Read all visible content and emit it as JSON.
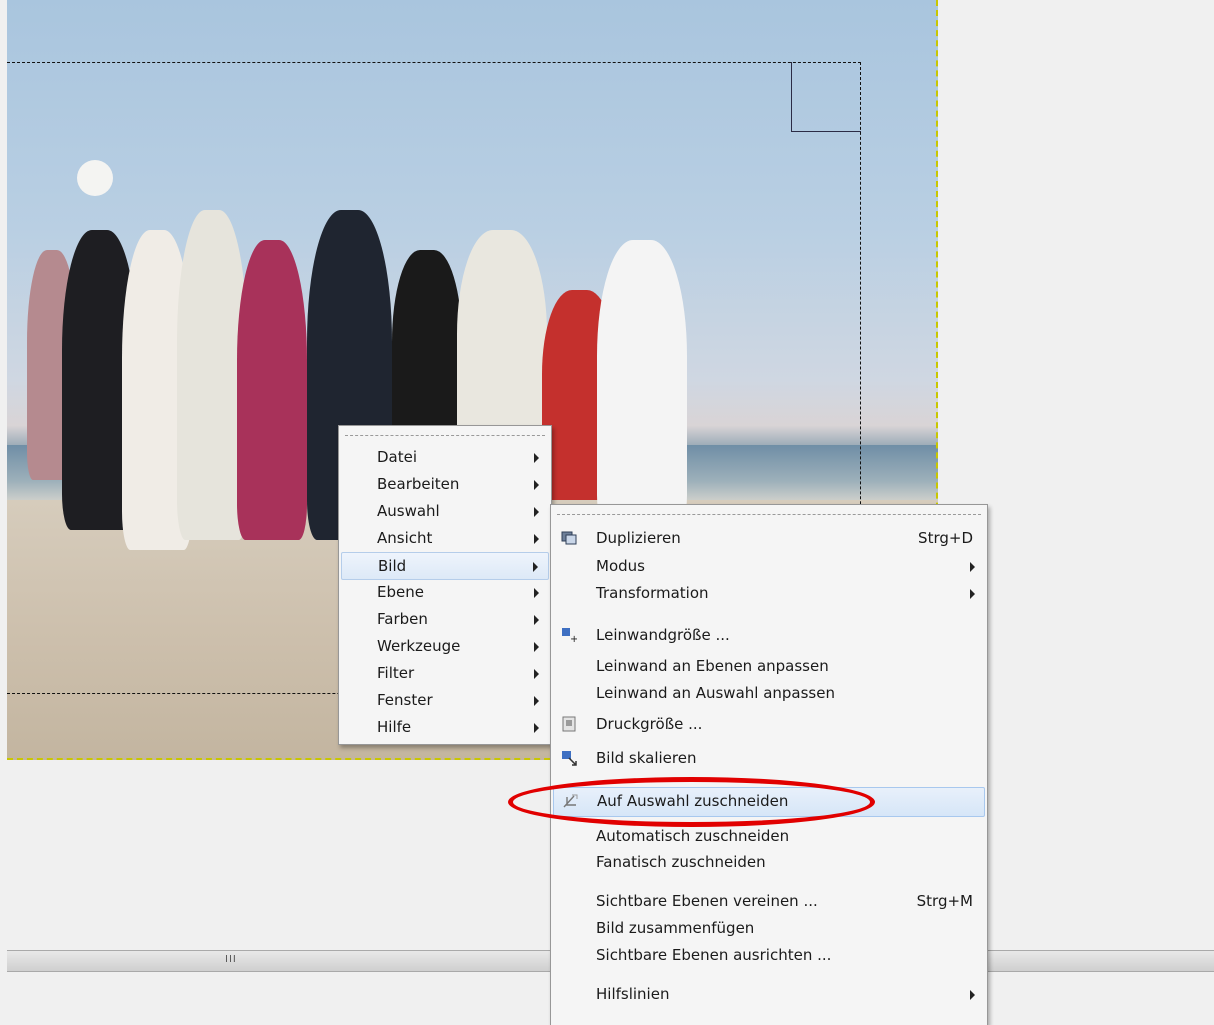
{
  "context_menu": {
    "items": [
      {
        "label": "Datei",
        "has_submenu": true
      },
      {
        "label": "Bearbeiten",
        "has_submenu": true
      },
      {
        "label": "Auswahl",
        "has_submenu": true
      },
      {
        "label": "Ansicht",
        "has_submenu": true
      },
      {
        "label": "Bild",
        "has_submenu": true,
        "active": true
      },
      {
        "label": "Ebene",
        "has_submenu": true
      },
      {
        "label": "Farben",
        "has_submenu": true
      },
      {
        "label": "Werkzeuge",
        "has_submenu": true
      },
      {
        "label": "Filter",
        "has_submenu": true
      },
      {
        "label": "Fenster",
        "has_submenu": true
      },
      {
        "label": "Hilfe",
        "has_submenu": true
      }
    ]
  },
  "bild_menu": {
    "items": [
      {
        "label": "Duplizieren",
        "shortcut": "Strg+D",
        "icon": "duplicate-icon"
      },
      {
        "label": "Modus",
        "has_submenu": true
      },
      {
        "label": "Transformation",
        "has_submenu": true
      },
      {
        "label": "Leinwandgröße ...",
        "icon": "canvas-size-icon"
      },
      {
        "label": "Leinwand an Ebenen anpassen"
      },
      {
        "label": "Leinwand an Auswahl anpassen"
      },
      {
        "label": "Druckgröße ...",
        "icon": "print-size-icon"
      },
      {
        "label": "Bild skalieren",
        "icon": "scale-image-icon"
      },
      {
        "label": "Auf Auswahl zuschneiden",
        "icon": "crop-icon",
        "highlighted": true
      },
      {
        "label": "Automatisch zuschneiden"
      },
      {
        "label": "Fanatisch zuschneiden"
      },
      {
        "label": "Sichtbare Ebenen vereinen ...",
        "shortcut": "Strg+M"
      },
      {
        "label": "Bild zusammenfügen"
      },
      {
        "label": "Sichtbare Ebenen ausrichten ..."
      },
      {
        "label": "Hilfslinien",
        "has_submenu": true
      }
    ]
  },
  "scrollbar": {
    "grip": "III"
  },
  "colors": {
    "annotation": "#e10000",
    "canvas_border": "#c9c700",
    "highlight": "#d6e6f8"
  }
}
